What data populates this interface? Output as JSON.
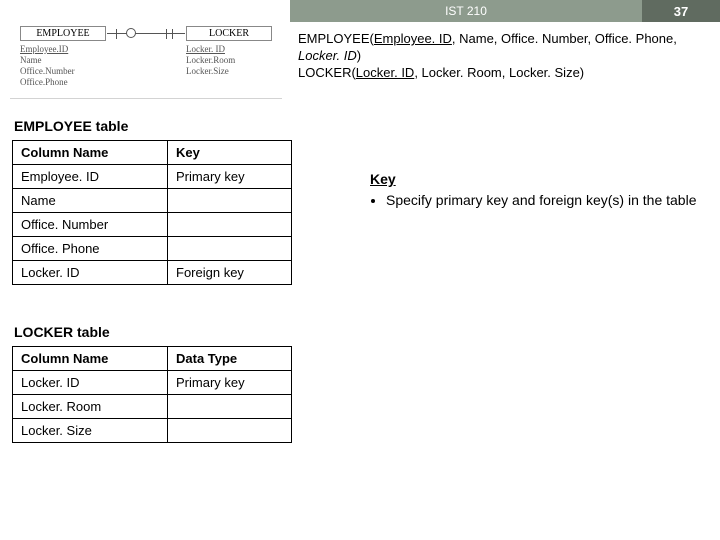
{
  "topbar": {
    "course": "IST 210",
    "slide_number": "37"
  },
  "er": {
    "left_entity": "EMPLOYEE",
    "right_entity": "LOCKER",
    "left_attrs": [
      "Employee.ID",
      "Name",
      "Office.Number",
      "Office.Phone"
    ],
    "right_attrs": [
      "Locker. ID",
      "Locker.Room",
      "Locker.Size"
    ]
  },
  "schema_text": {
    "line1_prefix": "EMPLOYEE(",
    "line1_pk": "Employee. ID",
    "line1_mid": ", Name, Office. Number, Office. Phone, ",
    "line1_fk": "Locker. ID",
    "line1_suffix": ")",
    "line2_prefix": "LOCKER(",
    "line2_pk": "Locker. ID",
    "line2_rest": ", Locker. Room, Locker. Size)"
  },
  "sections": {
    "employee_heading": "EMPLOYEE table",
    "locker_heading": "LOCKER table"
  },
  "employee_table": {
    "headers": [
      "Column Name",
      "Key"
    ],
    "rows": [
      {
        "col": "Employee. ID",
        "key": "Primary key"
      },
      {
        "col": "Name",
        "key": ""
      },
      {
        "col": "Office. Number",
        "key": ""
      },
      {
        "col": "Office. Phone",
        "key": ""
      },
      {
        "col": "Locker. ID",
        "key": "Foreign key"
      }
    ]
  },
  "locker_table": {
    "headers": [
      "Column Name",
      "Data Type"
    ],
    "rows": [
      {
        "col": "Locker. ID",
        "key": "Primary key"
      },
      {
        "col": "Locker. Room",
        "key": ""
      },
      {
        "col": "Locker. Size",
        "key": ""
      }
    ]
  },
  "keybox": {
    "title": "Key",
    "bullet": "Specify primary key and foreign key(s) in the table"
  }
}
